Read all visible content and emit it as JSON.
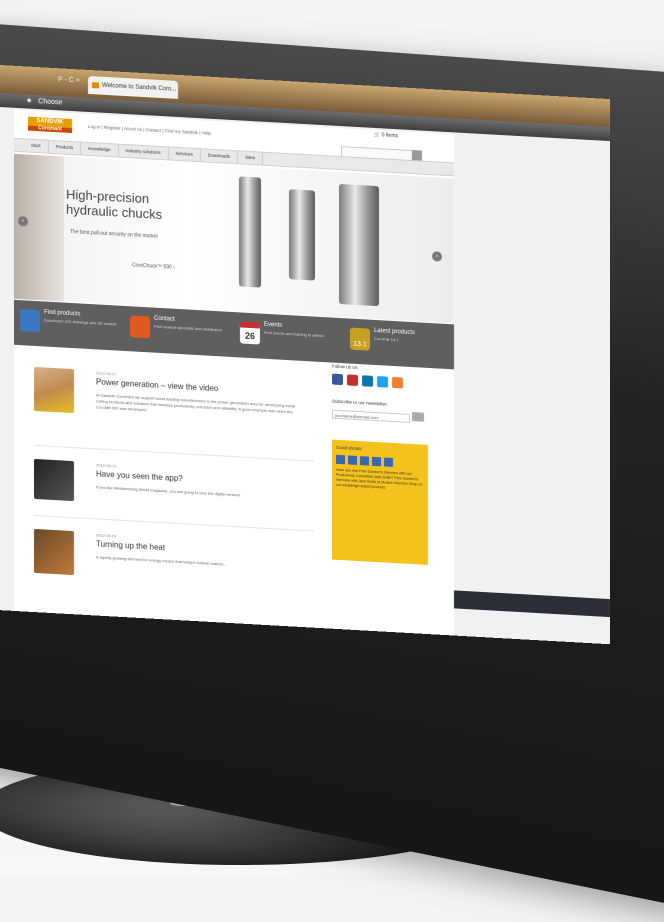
{
  "browser": {
    "tab_title": "Welcome to Sandvik Coro...",
    "nav_arrows": "P - C ×",
    "menu_label": "Choose"
  },
  "site": {
    "logo_top": "SANDVIK",
    "logo_bottom": "Coromant",
    "topnav": "Log in | Register | About us | Contact | Find my Sandvik | Help",
    "cart": "0 Items",
    "mainnav": [
      "Start",
      "Products",
      "Knowledge",
      "Industry solutions",
      "Services",
      "Downloads",
      "Sites"
    ]
  },
  "hero": {
    "title_line1": "High-precision",
    "title_line2": "hydraulic chucks",
    "subtitle": "The best pull-out security on the market",
    "link": "CoroChuck™ 930 ›"
  },
  "strip": [
    {
      "title": "Find products",
      "desc": "Download CAD drawings and 3D models",
      "icon_color": "#3a78c2"
    },
    {
      "title": "Contact",
      "desc": "Find nearest specialist and distributors",
      "icon_color": "#e05a20"
    },
    {
      "title": "Events",
      "desc": "Find events and training to attend",
      "icon_color": "#c43030",
      "badge": "26"
    },
    {
      "title": "Latest products",
      "desc": "CoroPak 13.1",
      "icon_color": "#c8a020",
      "badge": "13.1"
    }
  ],
  "articles": [
    {
      "date": "2012-09-17",
      "title": "Power generation – view the video",
      "body": "At Sandvik Coromant we support world leading manufacturers in the power generation area for developing metal cutting products and solutions that increase productivity, precision and reliability. A good example was when the CoroMill 690 was developed."
    },
    {
      "date": "2012-09-13",
      "title": "Have you seen the app?",
      "body": "If you like Metalworking World magazine, you are going to love the digital version!"
    },
    {
      "date": "2012-09-03",
      "title": "Turning up the heat",
      "body": "A rapidly growing demand for energy means that today's turbine makers..."
    }
  ],
  "sidebar": {
    "follow_label": "Follow us on:",
    "newsletter_label": "Subscribe to our newsletter:",
    "newsletter_placeholder": "yourname@domain.com",
    "box_title": "Good shouts",
    "box_text": "Have you met Pete Goheen's interview with our Productivity Consultant Jack Smith? Pete Goheen's interview with Jack Smith at Modern Machine Shop on our knowledge-based products"
  },
  "colors": {
    "accent": "#e8a000",
    "strip_bg": "#5f5f5f",
    "sidebar_box": "#f3c31c"
  }
}
